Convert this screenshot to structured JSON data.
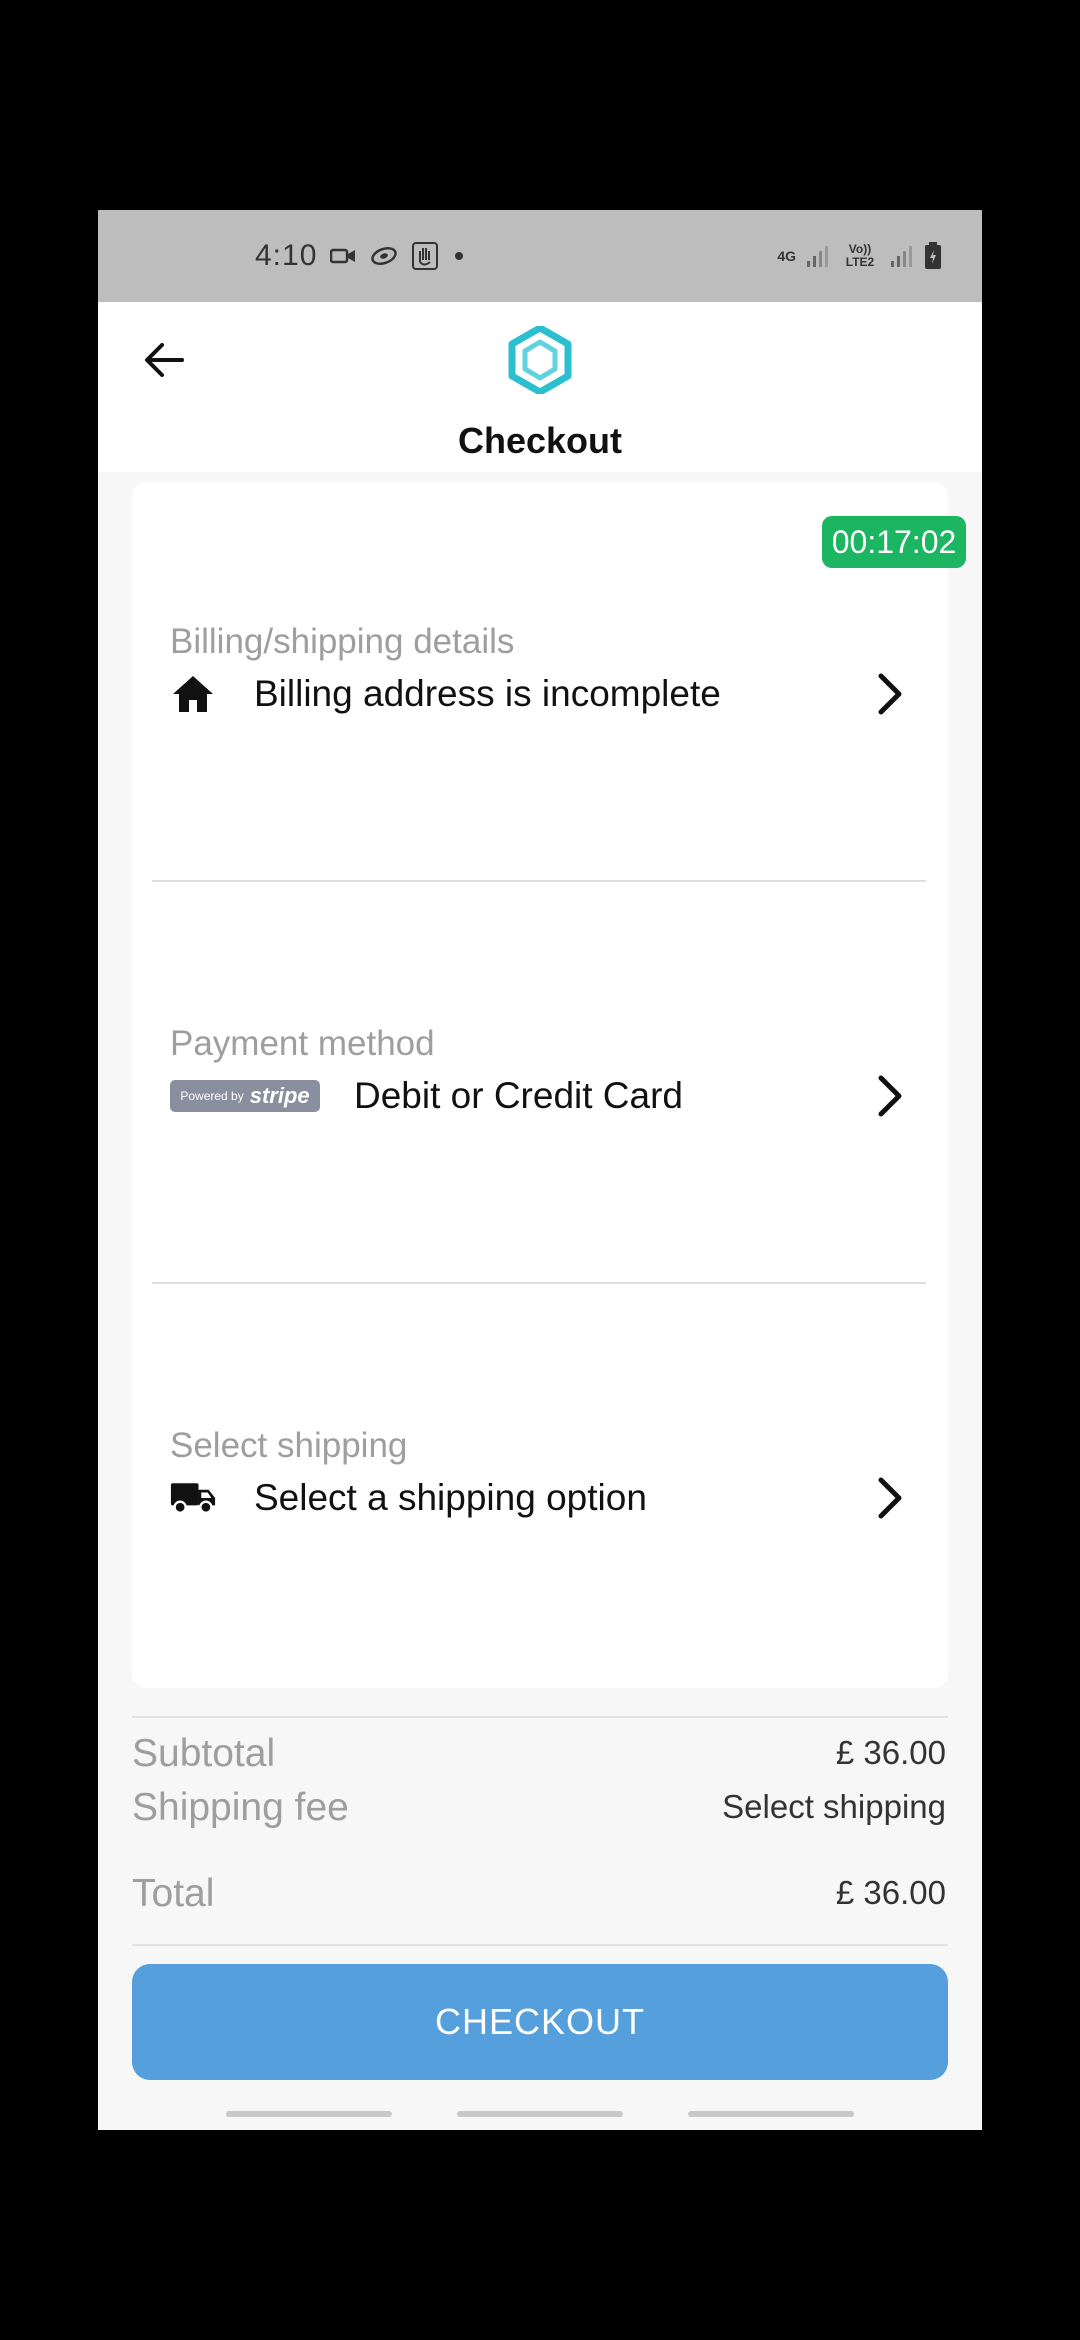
{
  "status_bar": {
    "time": "4:10",
    "network_left": "4G",
    "network_right": "Vo)) LTE2"
  },
  "header": {
    "title": "Checkout",
    "logo_color": "#2bbfd0"
  },
  "timer": "00:17:02",
  "sections": {
    "billing": {
      "label": "Billing/shipping details",
      "text": "Billing address is incomplete",
      "icon": "home-icon"
    },
    "payment": {
      "label": "Payment method",
      "badge_prefix": "Powered by",
      "badge_brand": "stripe",
      "text": "Debit or Credit Card"
    },
    "shipping": {
      "label": "Select shipping",
      "text": "Select a shipping option",
      "icon": "truck-icon"
    }
  },
  "summary": {
    "subtotal_label": "Subtotal",
    "subtotal_value": "£ 36.00",
    "shipping_label": "Shipping fee",
    "shipping_value": "Select shipping",
    "total_label": "Total",
    "total_value": "£ 36.00"
  },
  "checkout_button": "CHECKOUT",
  "colors": {
    "timer_bg": "#1cb561",
    "button_bg": "#549fdc",
    "status_bar_bg": "#bdbdbd"
  }
}
